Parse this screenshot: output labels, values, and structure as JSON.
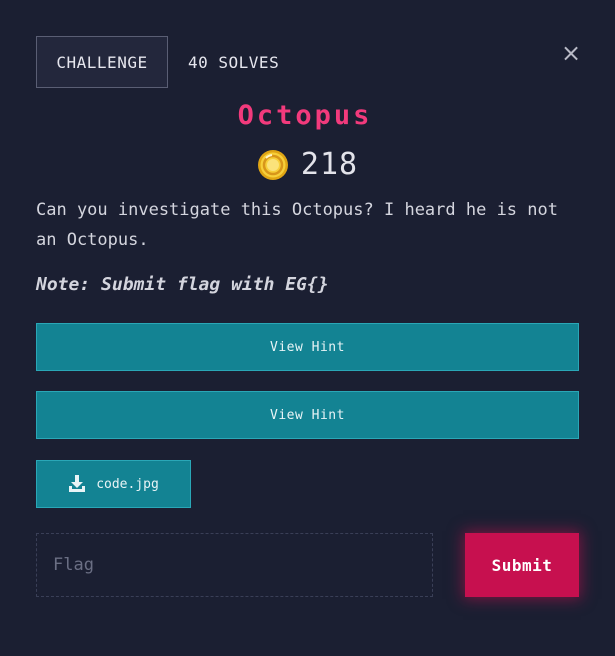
{
  "tabs": {
    "challenge_label": "CHALLENGE",
    "solves_label": "40 SOLVES"
  },
  "close_glyph": "×",
  "challenge": {
    "title": "Octopus",
    "points": "218",
    "description": "Can you investigate this Octopus? I heard he is not an Octopus.",
    "note": "Note: Submit flag with EG{}"
  },
  "hints": [
    {
      "label": "View Hint"
    },
    {
      "label": "View Hint"
    }
  ],
  "file": {
    "name": "code.jpg",
    "icon": "download-icon"
  },
  "flag_form": {
    "placeholder": "Flag",
    "value": "",
    "submit_label": "Submit"
  },
  "colors": {
    "background": "#1b1f32",
    "title": "#f23a7c",
    "hint_button": "#138393",
    "submit_button": "#c7104f",
    "coin": "#f2c230"
  }
}
